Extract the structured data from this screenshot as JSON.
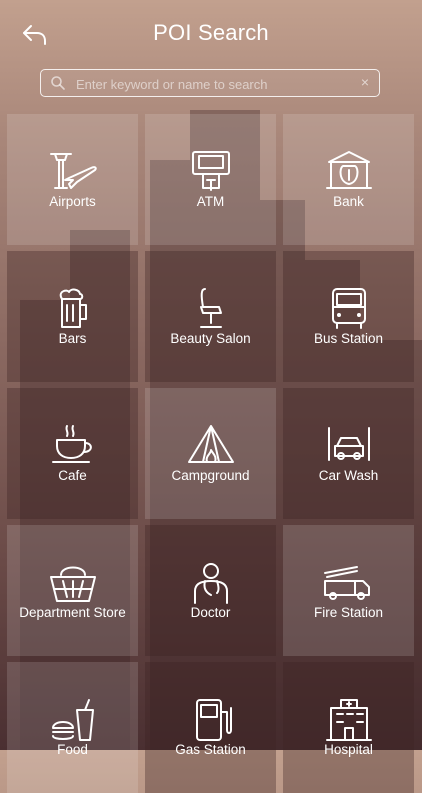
{
  "header": {
    "title": "POI Search",
    "back_icon": "back-arrow-icon"
  },
  "search": {
    "placeholder": "Enter keyword or name to search",
    "value": "",
    "clear_symbol": "×"
  },
  "categories": [
    {
      "label": "Airports",
      "icon": "airport-icon"
    },
    {
      "label": "ATM",
      "icon": "atm-icon"
    },
    {
      "label": "Bank",
      "icon": "bank-icon"
    },
    {
      "label": "Bars",
      "icon": "beer-mug-icon"
    },
    {
      "label": "Beauty Salon",
      "icon": "salon-chair-icon"
    },
    {
      "label": "Bus Station",
      "icon": "bus-icon"
    },
    {
      "label": "Cafe",
      "icon": "coffee-cup-icon"
    },
    {
      "label": "Campground",
      "icon": "tent-icon"
    },
    {
      "label": "Car Wash",
      "icon": "car-wash-icon"
    },
    {
      "label": "Department Store",
      "icon": "basket-icon"
    },
    {
      "label": "Doctor",
      "icon": "doctor-icon"
    },
    {
      "label": "Fire Station",
      "icon": "fire-truck-icon"
    },
    {
      "label": "Food",
      "icon": "fast-food-icon"
    },
    {
      "label": "Gas Station",
      "icon": "fuel-pump-icon"
    },
    {
      "label": "Hospital",
      "icon": "hospital-icon"
    }
  ],
  "colors": {
    "text": "#ffffff",
    "bg_top": "#c2a08e",
    "bg_bottom": "#4a2f31"
  }
}
